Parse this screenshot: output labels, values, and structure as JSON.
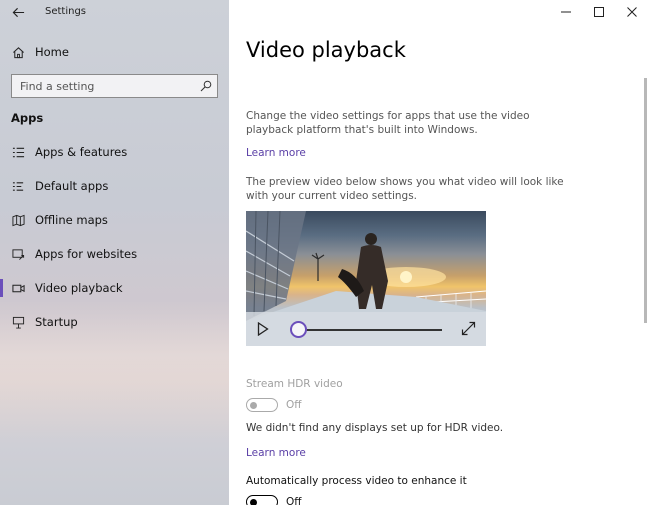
{
  "window": {
    "app_title": "Settings"
  },
  "sidebar": {
    "home_label": "Home",
    "search": {
      "placeholder": "Find a setting"
    },
    "section_heading": "Apps",
    "items": [
      {
        "label": "Apps & features",
        "icon": "list-icon"
      },
      {
        "label": "Default apps",
        "icon": "default-apps-icon"
      },
      {
        "label": "Offline maps",
        "icon": "map-icon"
      },
      {
        "label": "Apps for websites",
        "icon": "web-link-icon"
      },
      {
        "label": "Video playback",
        "icon": "video-icon",
        "selected": true
      },
      {
        "label": "Startup",
        "icon": "startup-icon"
      }
    ]
  },
  "main": {
    "title": "Video playback",
    "intro": "Change the video settings for apps that use the video playback platform that's built into Windows.",
    "learn_more_1": "Learn more",
    "preview_text": "The preview video below shows you what video will look like with your current video settings.",
    "player": {
      "progress": 0.0
    },
    "hdr": {
      "label": "Stream HDR video",
      "state": "Off",
      "enabled": false,
      "note": "We didn't find any displays set up for HDR video."
    },
    "learn_more_2": "Learn more",
    "auto_process": {
      "label": "Automatically process video to enhance it",
      "state": "Off"
    }
  },
  "colors": {
    "accent": "#6b4fbb",
    "link": "#5a3fa6"
  }
}
